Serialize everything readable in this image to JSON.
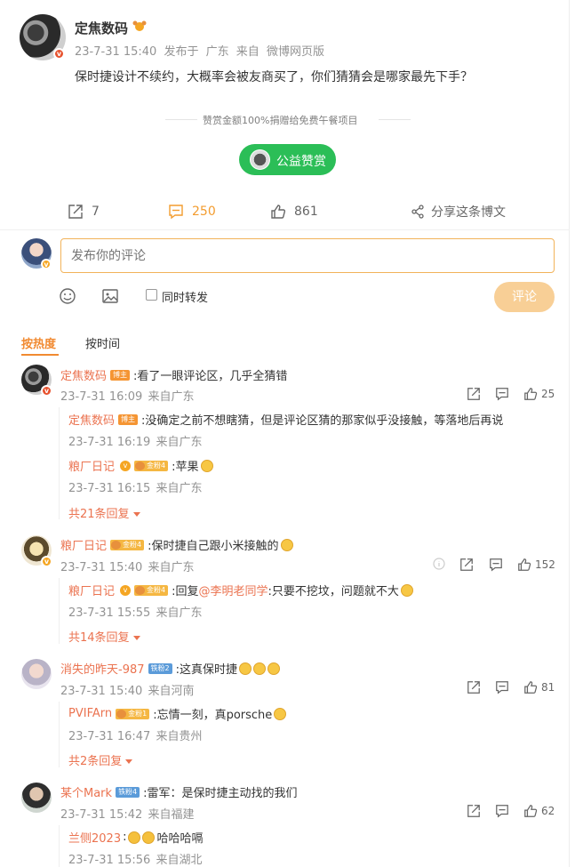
{
  "post": {
    "author": "定焦数码",
    "time": "23-7-31 15:40",
    "publish_prefix": "发布于",
    "location": "广东",
    "source_prefix": "来自",
    "source": "微博网页版",
    "text": "保时捷设计不续约，大概率会被友商买了，你们猜猜会是哪家最先下手？"
  },
  "reward": {
    "notice": "赞赏金额100%捐赠给免费午餐项目",
    "button_label": "公益赞赏"
  },
  "actions": {
    "repost_count": "7",
    "comment_count": "250",
    "like_count": "861",
    "share_label": "分享这条博文"
  },
  "composer": {
    "placeholder": "发布你的评论",
    "repost_label": "同时转发",
    "submit_label": "评论"
  },
  "sort": {
    "hot_label": "按热度",
    "time_label": "按时间"
  },
  "comments": [
    {
      "user": "定焦数码",
      "badge": "博主",
      "text": ":看了一眼评论区，几乎全猜错",
      "time": "23-7-31 16:09",
      "location": "来自广东",
      "likes": "25",
      "replies": [
        {
          "user": "定焦数码",
          "badge": "博主",
          "text": ":没确定之前不想瞎猜，但是评论区猜的那家似乎没接触，等落地后再说",
          "time": "23-7-31 16:19",
          "location": "来自广东"
        },
        {
          "user": "粮厂日记",
          "badge": "金粉4",
          "text": ":苹果",
          "time": "23-7-31 16:15",
          "location": "来自广东"
        }
      ],
      "more": "共21条回复"
    },
    {
      "user": "粮厂日记",
      "badge": "金粉4",
      "text": ":保时捷自己跟小米接触的",
      "time": "23-7-31 15:40",
      "location": "来自广东",
      "likes": "152",
      "replies": [
        {
          "user": "粮厂日记",
          "badge": "金粉4",
          "text_prefix": ":回复",
          "mention": "@李明老同学",
          "text": ":只要不挖坟，问题就不大",
          "time": "23-7-31 15:55",
          "location": "来自广东"
        }
      ],
      "more": "共14条回复"
    },
    {
      "user": "消失的昨天-987",
      "badge": "铁粉2",
      "text": ":这真保时捷",
      "time": "23-7-31 15:40",
      "location": "来自河南",
      "likes": "81",
      "replies": [
        {
          "user": "PVIFArn",
          "badge": "金粉1",
          "text": ":忘情一刻，真porsche",
          "time": "23-7-31 16:47",
          "location": "来自贵州"
        }
      ],
      "more": "共2条回复"
    },
    {
      "user": "某个Mark",
      "badge": "铁粉4",
      "text": ":雷军：是保时捷主动找的我们",
      "time": "23-7-31 15:42",
      "location": "来自福建",
      "likes": "62",
      "replies": [
        {
          "user": "兰侧2023",
          "text": "哈哈哈嗝",
          "time": "23-7-31 15:56",
          "location": "来自湖北"
        }
      ]
    }
  ],
  "colors": {
    "accent": "#f18a31",
    "username": "#eb7350",
    "reward_green": "#2bbe57",
    "submit_disabled": "#f8cf96",
    "input_border": "#f2b35a"
  }
}
